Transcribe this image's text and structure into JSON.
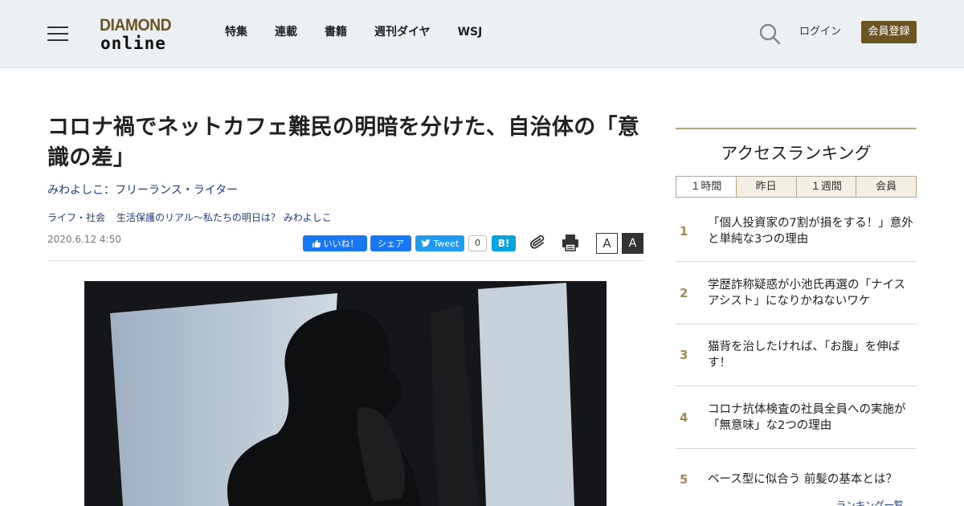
{
  "header": {
    "logo_top": "DIAMOND",
    "logo_bottom": "online",
    "nav": [
      "特集",
      "連載",
      "書籍",
      "週刊ダイヤ",
      "WSJ"
    ],
    "login": "ログイン",
    "register": "会員登録"
  },
  "article": {
    "title": "コロナ禍でネットカフェ難民の明暗を分けた、自治体の「意識の差」",
    "author": "みわよしこ：フリーランス・ライター",
    "tags": [
      "ライフ・社会",
      "生活保護のリアル～私たちの明日は？ みわよしこ"
    ],
    "date": "2020.6.12 4:50",
    "share": {
      "fb_like": "いいね！",
      "fb_share": "シェア",
      "tweet": "Tweet",
      "tweet_count": "0",
      "hatena": "B!",
      "font_small": "A",
      "font_large": "A"
    }
  },
  "sidebar": {
    "title": "アクセスランキング",
    "tabs": [
      "１時間",
      "昨日",
      "１週間",
      "会員"
    ],
    "ranking": [
      {
        "rank": "1",
        "text": "「個人投資家の7割が損をする！」意外と単純な3つの理由"
      },
      {
        "rank": "2",
        "text": "学歴詐称疑惑が小池氏再選の「ナイスアシスト」になりかねないワケ"
      },
      {
        "rank": "3",
        "text": "猫背を治したければ、「お腹」を伸ばす！"
      },
      {
        "rank": "4",
        "text": "コロナ抗体検査の社員全員への実施が「無意味」な2つの理由"
      },
      {
        "rank": "5",
        "text": "ベース型に似合う 前髪の基本とは？"
      }
    ],
    "more": "ランキング一覧"
  },
  "colors": {
    "brand_gold": "#6b5524",
    "link_blue": "#1f3b82",
    "facebook": "#1877f2",
    "twitter": "#1d9bf0",
    "hatena": "#00a4de"
  }
}
